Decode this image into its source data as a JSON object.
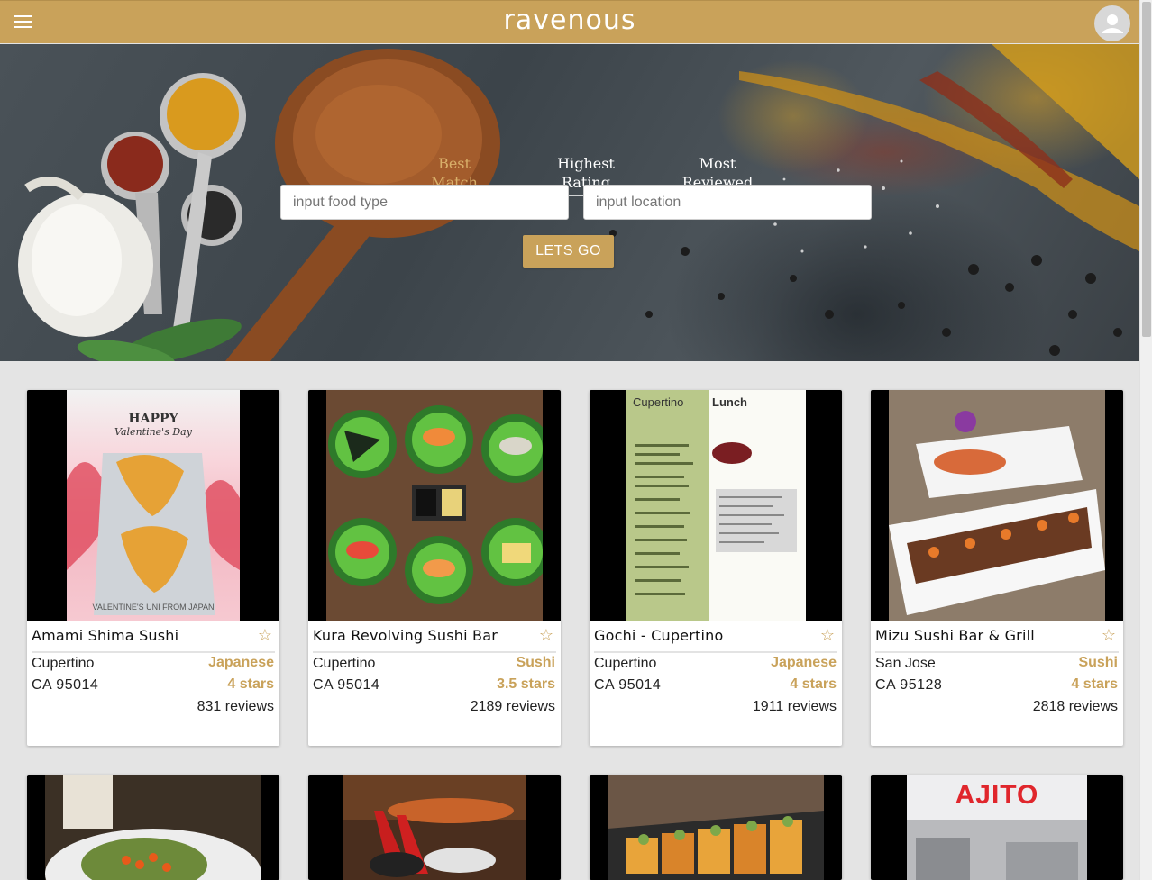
{
  "header": {
    "brand": "ravenous",
    "menu_icon": "hamburger-menu-icon",
    "avatar_icon": "user-avatar-icon",
    "accent": "#c9a25a"
  },
  "sort_tabs": [
    {
      "line1": "Best",
      "line2": "Match",
      "active": true
    },
    {
      "line1": "Highest",
      "line2": "Rating",
      "active": false
    },
    {
      "line1": "Most",
      "line2": "Reviewed",
      "active": false
    }
  ],
  "search": {
    "food_placeholder": "input food type",
    "location_placeholder": "input location",
    "submit_label": "LETS GO"
  },
  "businesses": [
    {
      "name": "Amami Shima Sushi",
      "city": "Cupertino",
      "state_zip": "CA  95014",
      "category": "Japanese",
      "rating": "4 stars",
      "reviews": "831 reviews",
      "photo_caption_top": "HAPPY",
      "photo_caption_sub": "Valentine's Day",
      "photo_caption_bottom": "VALENTINE'S UNI FROM JAPAN"
    },
    {
      "name": "Kura Revolving Sushi Bar",
      "city": "Cupertino",
      "state_zip": "CA  95014",
      "category": "Sushi",
      "rating": "3.5 stars",
      "reviews": "2189 reviews"
    },
    {
      "name": "Gochi - Cupertino",
      "city": "Cupertino",
      "state_zip": "CA  95014",
      "category": "Japanese",
      "rating": "4 stars",
      "reviews": "1911 reviews",
      "photo_caption_top": "Cupertino",
      "photo_caption_sub": "Lunch"
    },
    {
      "name": "Mizu Sushi Bar & Grill",
      "city": "San Jose",
      "state_zip": "CA  95128",
      "category": "Sushi",
      "rating": "4 stars",
      "reviews": "2818 reviews"
    }
  ],
  "second_row_sign": "AJITO",
  "favorite_icon": "star-outline-icon"
}
